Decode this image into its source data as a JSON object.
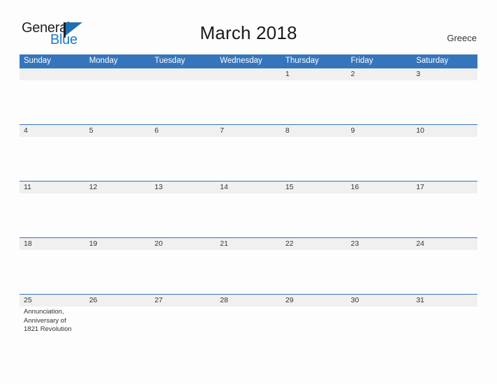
{
  "brand": {
    "word_one": "General",
    "word_two": "Blue",
    "flag_icon": "triangle-flag-icon",
    "accent_color": "#1f7ac4"
  },
  "header": {
    "title": "March 2018",
    "country": "Greece"
  },
  "colors": {
    "header_blue": "#3575bc",
    "date_band_gray": "#f0f0f0",
    "page_background": "#fdfdfd",
    "text": "#333333"
  },
  "calendar": {
    "weekdays": [
      "Sunday",
      "Monday",
      "Tuesday",
      "Wednesday",
      "Thursday",
      "Friday",
      "Saturday"
    ],
    "weeks": [
      {
        "days": [
          {
            "date": "",
            "event": ""
          },
          {
            "date": "",
            "event": ""
          },
          {
            "date": "",
            "event": ""
          },
          {
            "date": "",
            "event": ""
          },
          {
            "date": "1",
            "event": ""
          },
          {
            "date": "2",
            "event": ""
          },
          {
            "date": "3",
            "event": ""
          }
        ]
      },
      {
        "days": [
          {
            "date": "4",
            "event": ""
          },
          {
            "date": "5",
            "event": ""
          },
          {
            "date": "6",
            "event": ""
          },
          {
            "date": "7",
            "event": ""
          },
          {
            "date": "8",
            "event": ""
          },
          {
            "date": "9",
            "event": ""
          },
          {
            "date": "10",
            "event": ""
          }
        ]
      },
      {
        "days": [
          {
            "date": "11",
            "event": ""
          },
          {
            "date": "12",
            "event": ""
          },
          {
            "date": "13",
            "event": ""
          },
          {
            "date": "14",
            "event": ""
          },
          {
            "date": "15",
            "event": ""
          },
          {
            "date": "16",
            "event": ""
          },
          {
            "date": "17",
            "event": ""
          }
        ]
      },
      {
        "days": [
          {
            "date": "18",
            "event": ""
          },
          {
            "date": "19",
            "event": ""
          },
          {
            "date": "20",
            "event": ""
          },
          {
            "date": "21",
            "event": ""
          },
          {
            "date": "22",
            "event": ""
          },
          {
            "date": "23",
            "event": ""
          },
          {
            "date": "24",
            "event": ""
          }
        ]
      },
      {
        "days": [
          {
            "date": "25",
            "event": "Annunciation, Anniversary of 1821 Revolution"
          },
          {
            "date": "26",
            "event": ""
          },
          {
            "date": "27",
            "event": ""
          },
          {
            "date": "28",
            "event": ""
          },
          {
            "date": "29",
            "event": ""
          },
          {
            "date": "30",
            "event": ""
          },
          {
            "date": "31",
            "event": ""
          }
        ]
      }
    ]
  }
}
